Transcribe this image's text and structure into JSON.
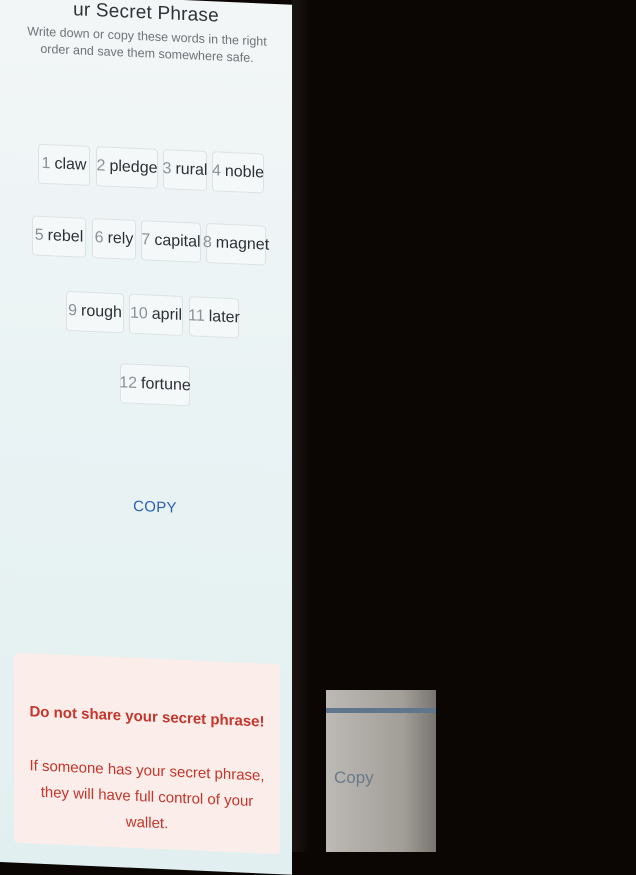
{
  "header": {
    "title": "ur Secret Phrase",
    "subtitle": "Write down or copy these words in the right order and save them somewhere safe."
  },
  "phrase": {
    "words": [
      {
        "num": "1",
        "word": "claw"
      },
      {
        "num": "2",
        "word": "pledge"
      },
      {
        "num": "3",
        "word": "rural"
      },
      {
        "num": "4",
        "word": "noble"
      },
      {
        "num": "5",
        "word": "rebel"
      },
      {
        "num": "6",
        "word": "rely"
      },
      {
        "num": "7",
        "word": "capital"
      },
      {
        "num": "8",
        "word": "magnet"
      },
      {
        "num": "9",
        "word": "rough"
      },
      {
        "num": "10",
        "word": "april"
      },
      {
        "num": "11",
        "word": "later"
      },
      {
        "num": "12",
        "word": "fortune"
      }
    ]
  },
  "actions": {
    "copy_label": "COPY"
  },
  "warning": {
    "title": "Do not share your secret phrase!",
    "body": "If someone has your secret phrase, they will have full control of your wallet."
  },
  "background_screen": {
    "copy_label": "Copy"
  }
}
